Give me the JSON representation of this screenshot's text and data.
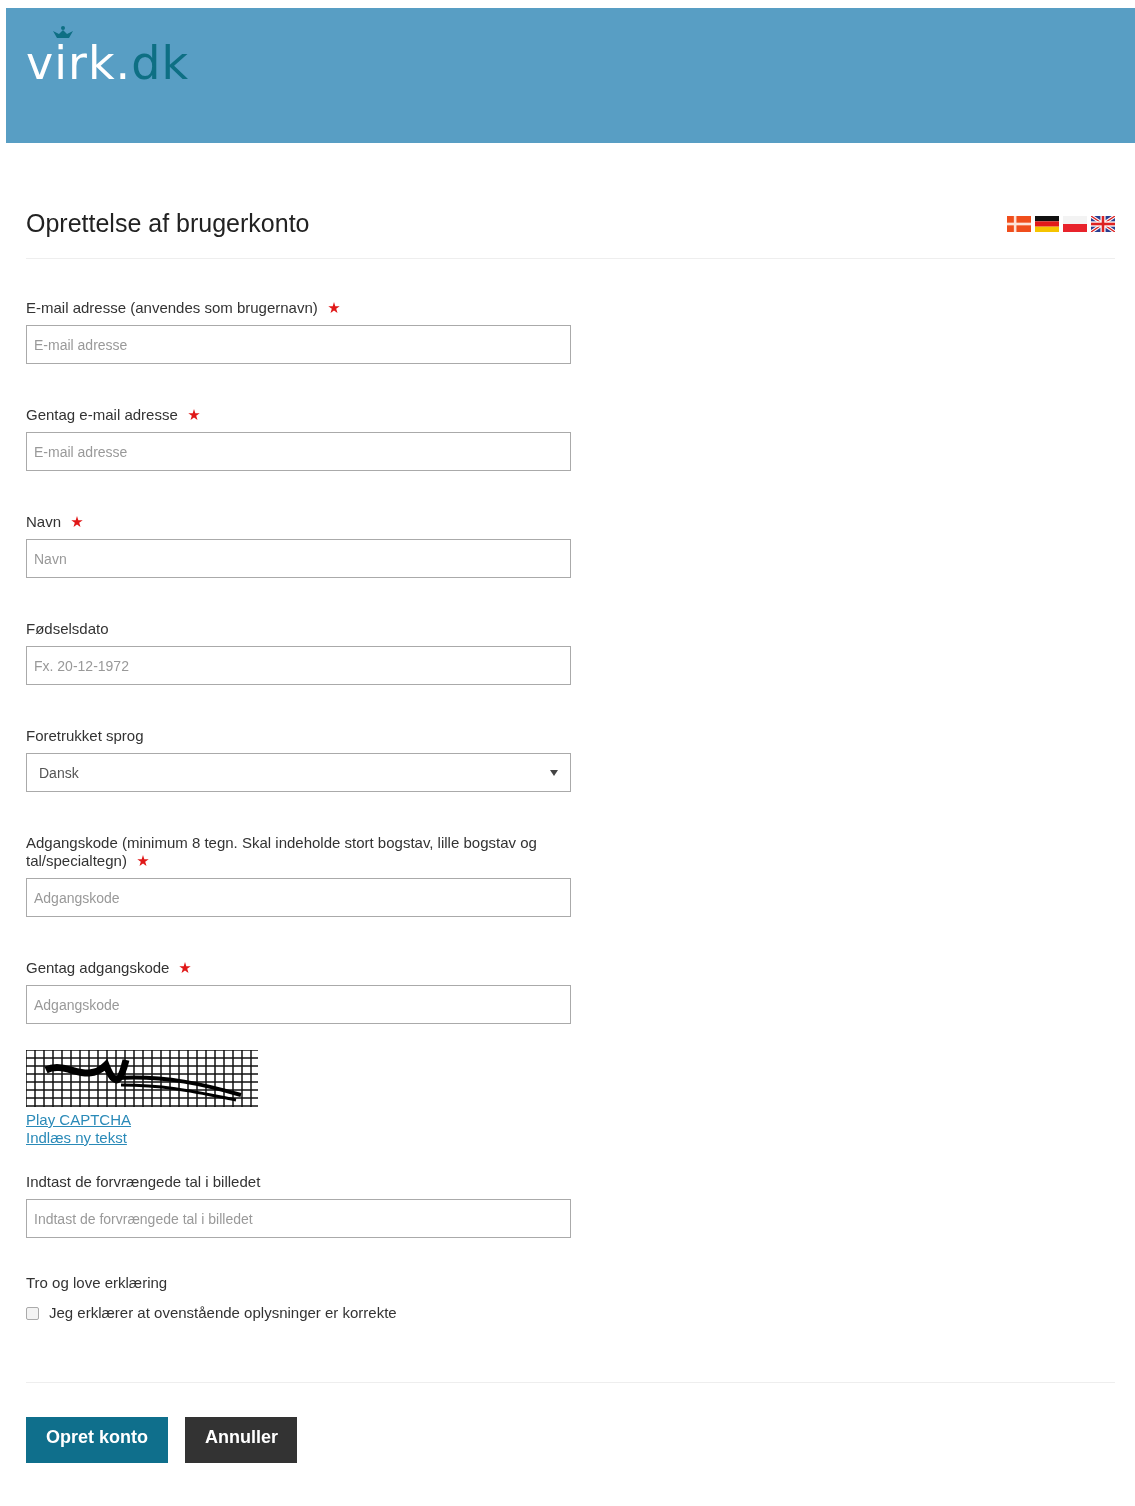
{
  "header": {
    "logo_main": "virk.",
    "logo_accent": "dk"
  },
  "page": {
    "title": "Oprettelse af brugerkonto",
    "languages": [
      {
        "kind": "da",
        "selected": false
      },
      {
        "kind": "de",
        "selected": false
      },
      {
        "kind": "pl",
        "selected": false
      },
      {
        "kind": "en",
        "selected": false
      }
    ]
  },
  "fields": [
    {
      "kind": "text",
      "label": "E-mail adresse (anvendes som brugernavn)",
      "required": true,
      "placeholder": "E-mail adresse"
    },
    {
      "kind": "text",
      "label": "Gentag e-mail adresse",
      "required": true,
      "placeholder": "E-mail adresse"
    },
    {
      "kind": "text",
      "label": "Navn",
      "required": true,
      "placeholder": "Navn"
    },
    {
      "kind": "text",
      "label": "Fødselsdato",
      "required": false,
      "placeholder": "Fx. 20-12-1972"
    },
    {
      "kind": "select",
      "label": "Foretrukket sprog",
      "required": false,
      "value": "Dansk"
    },
    {
      "kind": "password",
      "label": "Adgangskode (minimum 8 tegn. Skal indeholde stort bogstav, lille bogstav og tal/specialtegn)",
      "required": true,
      "placeholder": "Adgangskode"
    },
    {
      "kind": "password",
      "label": "Gentag adgangskode",
      "required": true,
      "placeholder": "Adgangskode"
    }
  ],
  "captcha": {
    "links": [
      "Play CAPTCHA",
      "Indlæs ny tekst"
    ],
    "label": "Indtast de forvrængede tal i billedet",
    "placeholder": "Indtast de forvrængede tal i billedet"
  },
  "declaration": {
    "heading": "Tro og love erklæring",
    "checkbox_label": "Jeg erklærer at ovenstående oplysninger er korrekte",
    "checked": false
  },
  "buttons": [
    {
      "kind": "primary",
      "label": "Opret konto"
    },
    {
      "kind": "secondary",
      "label": "Annuller"
    }
  ]
}
